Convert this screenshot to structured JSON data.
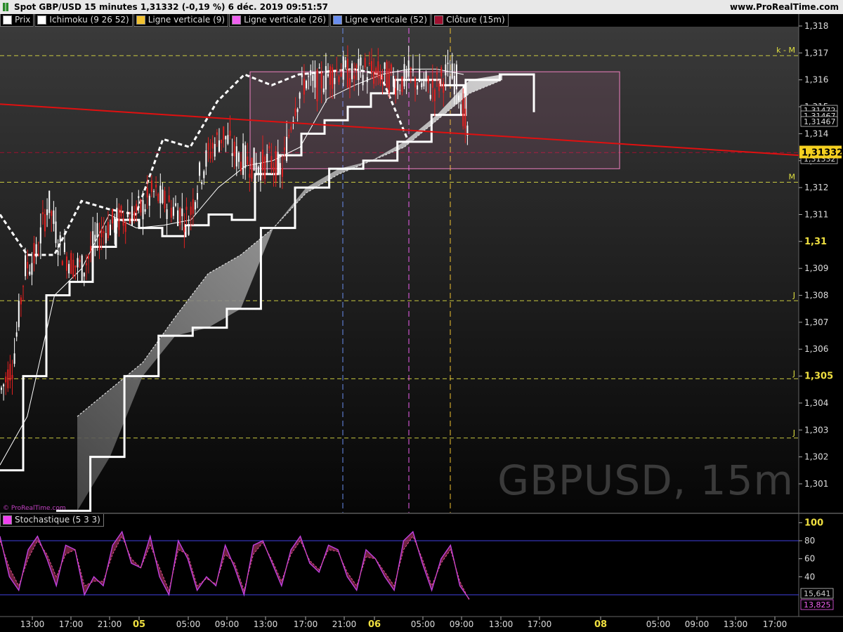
{
  "header": {
    "title": "Spot GBP/USD 15 minutes 1,31332 (-0,19 %) 6 déc. 2019 09:51:57",
    "site": "www.ProRealTime.com"
  },
  "watermark": "GBPUSD, 15m",
  "logo_text": "© ProRealTime.com",
  "legend": [
    {
      "label": "Prix",
      "color": "#ffffff"
    },
    {
      "label": "Ichimoku (9 26 52)",
      "color": "#ffffff"
    },
    {
      "label": "Ligne verticale (9)",
      "color": "#f2c230"
    },
    {
      "label": "Ligne verticale (26)",
      "color": "#f060f0"
    },
    {
      "label": "Ligne verticale (52)",
      "color": "#6a8ef0"
    },
    {
      "label": "Clôture (15m)",
      "color": "#a01030"
    }
  ],
  "stoch_legend": {
    "label": "Stochastique (5 3 3)",
    "color": "#f040f0"
  },
  "chart_data": [
    {
      "type": "line",
      "title": "Spot GBP/USD 15 minutes",
      "y_ticks": [
        "1,301",
        "1,302",
        "1,303",
        "1,304",
        "1,305",
        "1,306",
        "1,307",
        "1,308",
        "1,309",
        "1,31",
        "1,311",
        "1,312",
        "1,313",
        "1,314",
        "1,315",
        "1,316",
        "1,317",
        "1,318"
      ],
      "ylim": [
        1.3,
        1.3185
      ],
      "x_ticks": [
        "13:00",
        "17:00",
        "21:00",
        "05",
        "05:00",
        "09:00",
        "13:00",
        "17:00",
        "21:00",
        "06",
        "05:00",
        "09:00",
        "13:00",
        "17:00",
        "08",
        "05:00",
        "09:00",
        "13:00",
        "17:00"
      ],
      "last_price": "1,31332",
      "price_labels": [
        "1,31472",
        "1,31467",
        "1,31467",
        "1,31332"
      ],
      "horizontal_levels": [
        {
          "value": 1.3169,
          "label": "k - M",
          "color": "#c8c840"
        },
        {
          "value": 1.3122,
          "label": "M",
          "color": "#c8c840"
        },
        {
          "value": 1.3078,
          "label": "J",
          "color": "#c8c840"
        },
        {
          "value": 1.3049,
          "label": "J",
          "color": "#c8c840"
        },
        {
          "value": 1.3027,
          "label": "J",
          "color": "#c8c840"
        },
        {
          "value": 1.3133,
          "label": "",
          "color": "#a01030"
        }
      ],
      "vertical_lines": [
        {
          "name": "Ligne verticale (52)",
          "color": "#6a8ef0"
        },
        {
          "name": "Ligne verticale (26)",
          "color": "#f060f0"
        },
        {
          "name": "Ligne verticale (9)",
          "color": "#f2c230"
        }
      ],
      "trendline": {
        "y_start": 1.3151,
        "y_end": 1.3132,
        "color": "#e01010"
      },
      "range_box": {
        "y_top": 1.3163,
        "y_bottom": 1.3127,
        "color": "#f080c0"
      },
      "series": [
        {
          "name": "Prix",
          "values": [
            1.3045,
            1.3055,
            1.309,
            1.3095,
            1.3115,
            1.3098,
            1.3092,
            1.309,
            1.31,
            1.3105,
            1.3108,
            1.311,
            1.3112,
            1.3118,
            1.3114,
            1.3112,
            1.3108,
            1.3125,
            1.3135,
            1.314,
            1.3132,
            1.313,
            1.3128,
            1.313,
            1.3126,
            1.315,
            1.316,
            1.3158,
            1.3162,
            1.3164,
            1.3161,
            1.3164,
            1.3162,
            1.3161,
            1.3159,
            1.3162,
            1.3158,
            1.3157,
            1.3162,
            1.316,
            1.3135
          ]
        },
        {
          "name": "Tenkan",
          "values": [
            1.3015,
            1.305,
            1.308,
            1.3085,
            1.3098,
            1.3108,
            1.3105,
            1.3102,
            1.3106,
            1.311,
            1.3108,
            1.3125,
            1.3132,
            1.314,
            1.3145,
            1.315,
            1.3155,
            1.316,
            1.316,
            1.3158,
            1.3155
          ]
        },
        {
          "name": "Kijun",
          "values": [
            1.3017,
            1.3035,
            1.308,
            1.309,
            1.311,
            1.3105,
            1.3106,
            1.3108,
            1.312,
            1.3128,
            1.313,
            1.3135,
            1.3153,
            1.3158,
            1.3162,
            1.3164,
            1.3164,
            1.3162
          ]
        },
        {
          "name": "Chikou",
          "values": [
            1.311,
            1.3095,
            1.3095,
            1.3115,
            1.3112,
            1.311,
            1.3138,
            1.3135,
            1.3152,
            1.3162,
            1.3158,
            1.3162,
            1.3163,
            1.3164,
            1.3162,
            1.3138
          ]
        },
        {
          "name": "Senkou A",
          "values": [
            1.3035,
            1.3045,
            1.3055,
            1.3072,
            1.3088,
            1.3095,
            1.3105,
            1.3118,
            1.3125,
            1.313,
            1.3135,
            1.3145,
            1.3155,
            1.316
          ]
        },
        {
          "name": "Senkou B",
          "values": [
            1.3,
            1.302,
            1.305,
            1.3065,
            1.3068,
            1.3075,
            1.3105,
            1.312,
            1.3127,
            1.313,
            1.3137,
            1.3147,
            1.316,
            1.3162,
            1.3148
          ]
        }
      ]
    },
    {
      "type": "line",
      "title": "Stochastique (5 3 3)",
      "y_ticks": [
        "20",
        "40",
        "60",
        "80",
        "100"
      ],
      "ylim": [
        0,
        100
      ],
      "levels": [
        20,
        80
      ],
      "last_values": [
        "15,641",
        "13,825"
      ],
      "series": [
        {
          "name": "%K",
          "color": "#c040e0",
          "values": [
            85,
            40,
            25,
            70,
            85,
            60,
            30,
            75,
            70,
            20,
            40,
            30,
            75,
            90,
            55,
            50,
            85,
            40,
            20,
            80,
            60,
            25,
            40,
            30,
            75,
            50,
            20,
            75,
            80,
            55,
            30,
            70,
            85,
            55,
            45,
            75,
            70,
            40,
            25,
            70,
            60,
            40,
            25,
            80,
            90,
            55,
            25,
            60,
            75,
            30,
            15
          ]
        },
        {
          "name": "%D",
          "color": "#e05090",
          "values": [
            80,
            50,
            30,
            60,
            80,
            65,
            40,
            65,
            70,
            30,
            35,
            35,
            65,
            85,
            60,
            50,
            75,
            50,
            25,
            70,
            65,
            30,
            38,
            32,
            65,
            55,
            25,
            65,
            78,
            58,
            35,
            65,
            80,
            58,
            48,
            70,
            68,
            45,
            30,
            62,
            60,
            45,
            30,
            70,
            85,
            60,
            30,
            55,
            70,
            35,
            14
          ]
        }
      ]
    }
  ]
}
